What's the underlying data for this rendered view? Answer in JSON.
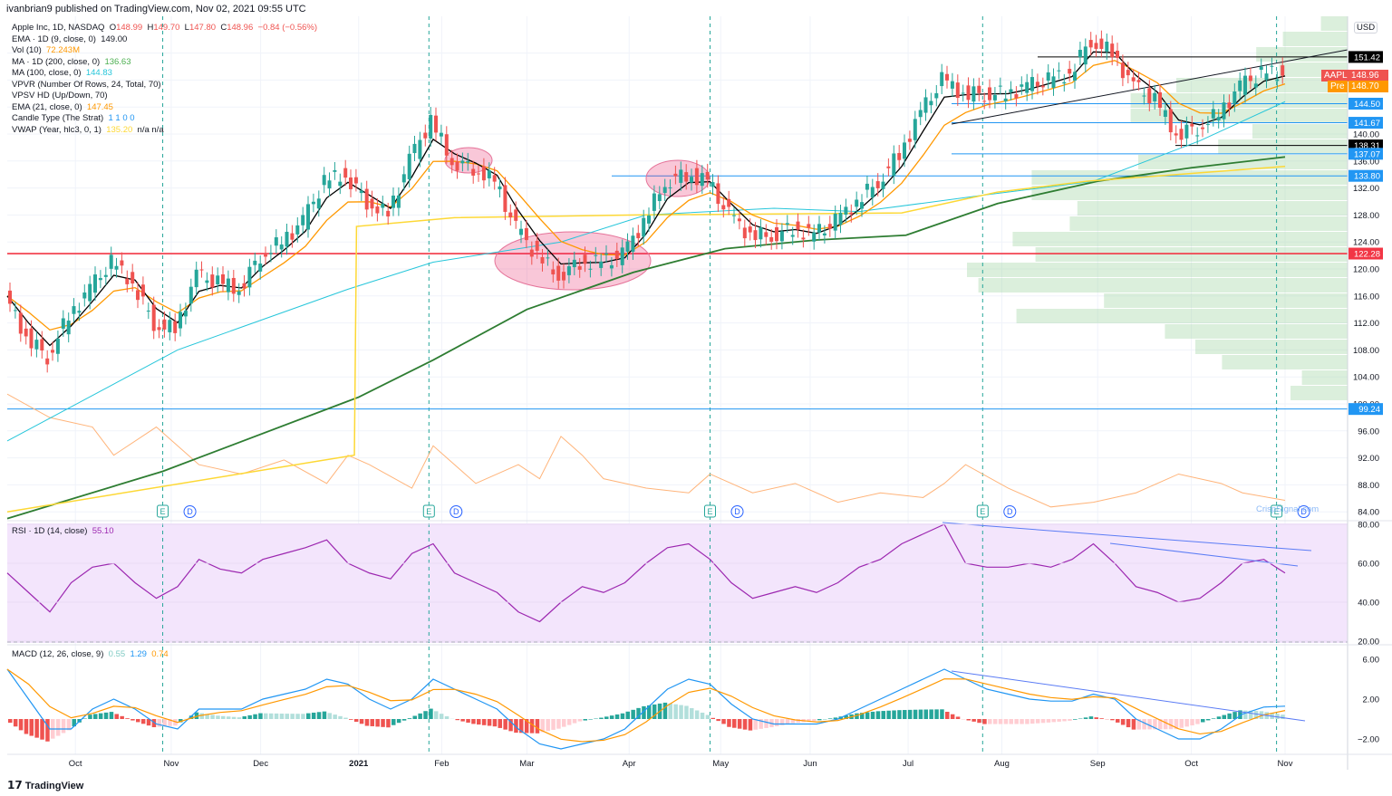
{
  "header": {
    "published": "ivanbrian9 published on TradingView.com, Nov 02, 2021 09:55 UTC"
  },
  "legend": {
    "symbol": "Apple Inc, 1D, NASDAQ",
    "o_label": "O",
    "o": "148.99",
    "h_label": "H",
    "h": "149.70",
    "l_label": "L",
    "l": "147.80",
    "c_label": "C",
    "c": "148.96",
    "change": "−0.84 (−0.56%)",
    "ema9": "EMA · 1D (9, close, 0)",
    "ema9_val": "149.00",
    "vol": "Vol (10)",
    "vol_val": "72.243M",
    "ma200": "MA · 1D (200, close, 0)",
    "ma200_val": "136.63",
    "ma100": "MA (100, close, 0)",
    "ma100_val": "144.83",
    "vpvr": "VPVR (Number Of Rows, 24, Total, 70)",
    "vpsv": "VPSV HD (Up/Down, 70)",
    "ema21": "EMA (21, close, 0)",
    "ema21_val": "147.45",
    "candle": "Candle Type (The Strat)",
    "candle_val": "1  1  0  0",
    "vwap": "VWAP (Year, hlc3, 0, 1)",
    "vwap_val": "135.20",
    "vwap_na": "n/a  n/a"
  },
  "rsi_legend": {
    "label": "RSI · 1D (14, close)",
    "value": "55.10"
  },
  "macd_legend": {
    "label": "MACD (12, 26, close, 9)",
    "hist": "0.55",
    "macd": "1.29",
    "signal": "0.74"
  },
  "currency": "USD",
  "price_tags": {
    "symbol": "AAPL",
    "last": "148.96",
    "pre_label": "Pre",
    "pre": "148.70"
  },
  "footer": {
    "brand": "TradingView"
  },
  "watermark": "CrispSignal.com",
  "colors": {
    "up": "#26a69a",
    "down": "#ef5350",
    "ema9": "#000000",
    "ema21": "#ff9800",
    "ma100": "#26c6da",
    "ma200": "#2e7d32",
    "vwap": "#fdd835",
    "vol": "#ffb47a",
    "rsi": "#9c27b0",
    "macd": "#2196f3",
    "signal": "#ff9800"
  },
  "chart_data": [
    {
      "type": "candlestick",
      "title": "Apple Inc, 1D, NASDAQ",
      "x_unit": "weeks since 2020-09-07",
      "ylim": [
        82,
        158
      ],
      "yticks": [
        84,
        88,
        92,
        96,
        100,
        104,
        108,
        112,
        116,
        120,
        124,
        128,
        132,
        136,
        140,
        144,
        148,
        152
      ],
      "xticks": [
        {
          "label": "Oct",
          "x": 3.2
        },
        {
          "label": "Nov",
          "x": 7.7
        },
        {
          "label": "Dec",
          "x": 11.9
        },
        {
          "label": "2021",
          "x": 16.5
        },
        {
          "label": "Feb",
          "x": 20.4
        },
        {
          "label": "Mar",
          "x": 24.4
        },
        {
          "label": "Apr",
          "x": 29.2
        },
        {
          "label": "May",
          "x": 33.5
        },
        {
          "label": "Jun",
          "x": 37.7
        },
        {
          "label": "Jul",
          "x": 42.3
        },
        {
          "label": "Aug",
          "x": 46.7
        },
        {
          "label": "Sep",
          "x": 51.2
        },
        {
          "label": "Oct",
          "x": 55.6
        },
        {
          "label": "Nov",
          "x": 60
        }
      ],
      "closes": [
        116,
        110,
        107,
        113,
        117,
        121,
        118,
        112,
        111,
        119,
        118,
        117,
        122,
        124,
        127,
        133,
        134,
        130,
        128,
        136,
        142,
        136,
        135,
        133,
        126,
        122,
        119,
        121,
        121,
        122,
        127,
        133,
        134,
        133,
        128,
        125,
        125,
        126,
        125,
        127,
        130,
        133,
        137,
        143,
        148,
        146,
        146,
        146,
        147,
        148,
        149,
        154,
        152,
        147,
        145,
        140,
        141,
        143,
        147,
        149,
        149
      ],
      "ma200": [
        [
          0,
          83
        ],
        [
          7.3,
          90
        ],
        [
          16.5,
          101
        ],
        [
          20,
          106.5
        ],
        [
          24.4,
          114
        ],
        [
          29.4,
          119.5
        ],
        [
          33.7,
          123
        ],
        [
          38,
          124.3
        ],
        [
          42.2,
          125
        ],
        [
          46.5,
          129.7
        ],
        [
          51.2,
          133
        ],
        [
          55.6,
          135
        ],
        [
          60,
          136.6
        ]
      ],
      "ma100": [
        [
          0,
          94.5
        ],
        [
          8,
          108
        ],
        [
          16,
          117
        ],
        [
          20,
          121
        ],
        [
          26,
          124
        ],
        [
          30,
          128
        ],
        [
          36,
          129
        ],
        [
          40,
          128.5
        ],
        [
          46,
          131
        ],
        [
          51,
          133
        ],
        [
          56,
          139
        ],
        [
          60,
          144.8
        ]
      ],
      "vwap": [
        [
          0,
          84
        ],
        [
          16.3,
          92.4
        ],
        [
          16.4,
          126.3
        ],
        [
          21,
          127.6
        ],
        [
          29.5,
          128
        ],
        [
          42,
          128.3
        ],
        [
          46.5,
          131.4
        ],
        [
          50.7,
          133
        ],
        [
          60,
          135.2
        ]
      ],
      "volume_avg_m": [
        [
          0,
          185
        ],
        [
          2,
          160
        ],
        [
          4,
          150
        ],
        [
          5,
          120
        ],
        [
          7,
          150
        ],
        [
          9,
          110
        ],
        [
          11,
          100
        ],
        [
          13,
          115
        ],
        [
          15,
          90
        ],
        [
          16,
          120
        ],
        [
          17,
          110
        ],
        [
          19,
          85
        ],
        [
          20,
          130
        ],
        [
          22,
          90
        ],
        [
          24,
          110
        ],
        [
          25,
          95
        ],
        [
          26,
          140
        ],
        [
          27,
          120
        ],
        [
          28,
          95
        ],
        [
          30,
          85
        ],
        [
          32,
          80
        ],
        [
          33,
          100
        ],
        [
          35,
          80
        ],
        [
          37,
          90
        ],
        [
          39,
          70
        ],
        [
          41,
          80
        ],
        [
          43,
          75
        ],
        [
          44,
          90
        ],
        [
          45,
          110
        ],
        [
          47,
          85
        ],
        [
          49,
          65
        ],
        [
          51,
          70
        ],
        [
          53,
          80
        ],
        [
          55,
          100
        ],
        [
          57,
          90
        ],
        [
          58,
          80
        ],
        [
          60,
          72
        ]
      ],
      "levels": [
        {
          "price": "151.42",
          "color": "#000000"
        },
        {
          "price": "144.50",
          "color": "#2196f3"
        },
        {
          "price": "141.67",
          "color": "#2196f3"
        },
        {
          "price": "138.31",
          "color": "#000000"
        },
        {
          "price": "137.07",
          "color": "#2196f3"
        },
        {
          "price": "133.80",
          "color": "#2196f3"
        },
        {
          "price": "122.28",
          "color": "#f23645"
        },
        {
          "price": "99.24",
          "color": "#2196f3"
        }
      ],
      "events": [
        {
          "x": 7.3,
          "e": "E",
          "d": "D"
        },
        {
          "x": 19.8,
          "e": "E",
          "d": "D"
        },
        {
          "x": 33,
          "e": "E",
          "d": "D"
        },
        {
          "x": 45.8,
          "e": "E",
          "d": "D"
        },
        {
          "x": 59.6,
          "e": "E",
          "d": "D"
        }
      ],
      "vpvr_rows": [
        0.07,
        0.17,
        0.24,
        0.18,
        0.45,
        0.57,
        0.57,
        0.25,
        0.34,
        0.55,
        0.83,
        0.83,
        0.71,
        0.73,
        0.88,
        0.82,
        1.0,
        0.97,
        0.64,
        0.87,
        0.48,
        0.4,
        0.33,
        0.12,
        0.15
      ]
    },
    {
      "type": "line",
      "title": "RSI · 1D (14, close)",
      "ylim": [
        20,
        80
      ],
      "yticks": [
        20,
        40,
        60,
        80
      ],
      "values": [
        55,
        45,
        35,
        50,
        58,
        60,
        50,
        42,
        48,
        62,
        57,
        55,
        62,
        65,
        68,
        72,
        60,
        55,
        52,
        65,
        70,
        55,
        50,
        45,
        35,
        30,
        40,
        48,
        45,
        50,
        60,
        68,
        70,
        62,
        50,
        42,
        45,
        48,
        45,
        50,
        58,
        62,
        70,
        75,
        80,
        60,
        58,
        58,
        60,
        58,
        62,
        70,
        60,
        48,
        45,
        40,
        42,
        50,
        60,
        62,
        55
      ]
    },
    {
      "type": "line",
      "title": "MACD (12, 26, close, 9)",
      "ylim": [
        -3.5,
        6.5
      ],
      "yticks": [
        -2,
        2,
        6
      ],
      "macd": [
        5,
        2,
        -1,
        -1,
        1,
        2,
        1,
        -0.5,
        -1,
        1,
        1,
        1,
        2,
        2.5,
        3,
        4,
        3.5,
        2,
        1,
        2,
        4,
        3,
        2,
        1,
        -1,
        -2.5,
        -3,
        -2.5,
        -2,
        -1,
        1,
        3,
        4,
        3.5,
        1.5,
        0,
        -0.5,
        -0.5,
        -0.5,
        0,
        1,
        2,
        3,
        4,
        5,
        4,
        3,
        2.5,
        2,
        1.8,
        1.8,
        2.5,
        2,
        0,
        -1,
        -2,
        -2,
        -1,
        0.5,
        1.2,
        1.29
      ]
    }
  ]
}
